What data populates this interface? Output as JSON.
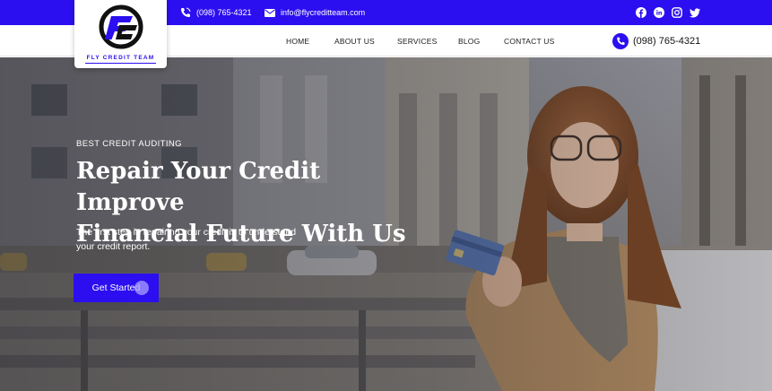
{
  "topbar": {
    "phone": "(098) 765-4321",
    "email": "info@flycreditteam.com",
    "socials": [
      "facebook-icon",
      "linkedin-icon",
      "instagram-icon",
      "twitter-icon"
    ]
  },
  "logo": {
    "text": "FLY CREDIT TEAM"
  },
  "nav": {
    "items": [
      {
        "label": "HOME"
      },
      {
        "label": "ABOUT US"
      },
      {
        "label": "SERVICES"
      },
      {
        "label": "BLOG"
      },
      {
        "label": "CONTACT US"
      }
    ],
    "phone": "(098) 765-4321"
  },
  "hero": {
    "eyebrow": "BEST CREDIT AUDITING",
    "title_line1": "Repair Your Credit Improve",
    "title_line2": "Financial Future With Us",
    "subtitle_line1": "The first step in repairing your credit is to understand",
    "subtitle_line2": "your credit report.",
    "cta": "Get Started"
  },
  "colors": {
    "brand": "#2b0ff0",
    "nav_bg": "#ffffff",
    "text_dark": "#111111"
  }
}
